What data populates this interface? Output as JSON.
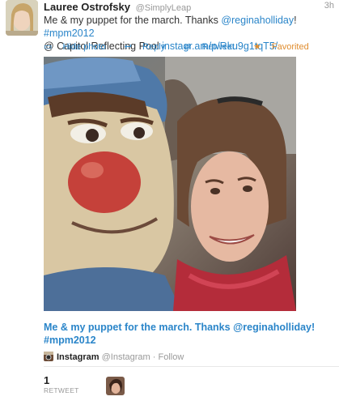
{
  "tweet": {
    "author_name": "Lauree Ostrofsky",
    "author_handle": "@SimplyLeap",
    "time": "3h",
    "text_before": "Me & my puppet for the march. Thanks ",
    "mention": "@reginaholliday",
    "hashtag": "#mpm2012",
    "location": "@ Capitol Reflecting Pool",
    "url": "instagr.am/p/Rku9g1tqT5/"
  },
  "actions": {
    "hide_photo": "Hide photo",
    "reply": "Reply",
    "retweet": "Retweet",
    "favorited": "Favorited"
  },
  "media": {
    "caption": "Me & my puppet for the march. Thanks @reginaholliday! #mpm2012",
    "source_name": "Instagram",
    "source_handle": "@Instagram",
    "follow": "Follow"
  },
  "stats": {
    "retweet_count": "1",
    "retweet_label": "RETWEET"
  },
  "colors": {
    "link": "#2a85c9",
    "favorite": "#e08d2f"
  }
}
